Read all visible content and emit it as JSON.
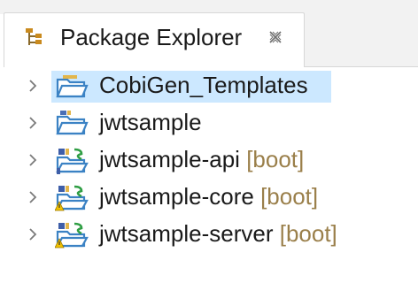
{
  "view": {
    "title": "Package Explorer",
    "icon": "package-explorer-icon",
    "close_icon": "close-icon"
  },
  "tree": {
    "items": [
      {
        "name": "CobiGen_Templates",
        "decoration": "",
        "icon": "folder-project-icon",
        "selected": true
      },
      {
        "name": "jwtsample",
        "decoration": "",
        "icon": "folder-project-icon",
        "selected": false
      },
      {
        "name": "jwtsample-api",
        "decoration": "[boot]",
        "icon": "maven-spring-project-icon",
        "selected": false
      },
      {
        "name": "jwtsample-core",
        "decoration": "[boot]",
        "icon": "maven-spring-project-warning-icon",
        "selected": false
      },
      {
        "name": "jwtsample-server",
        "decoration": "[boot]",
        "icon": "maven-spring-project-warning-icon",
        "selected": false
      }
    ]
  },
  "colors": {
    "selection": "#cce8ff",
    "decoration": "#9a7f4a",
    "folder_blue": "#3b82c4",
    "spring_green": "#2f9e44",
    "warning_yellow": "#f2c200"
  }
}
